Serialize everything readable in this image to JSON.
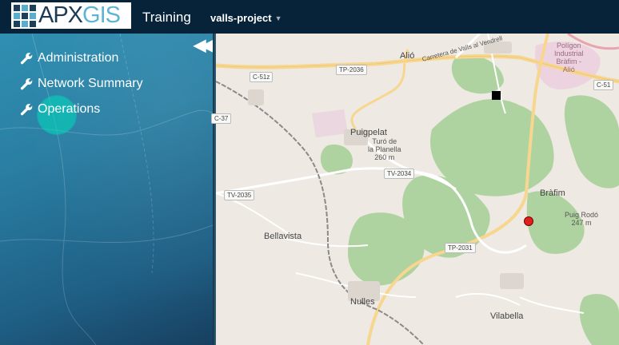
{
  "header": {
    "logo_part1": "APX",
    "logo_part2": "GIS",
    "app_title": "Training",
    "project": "valls-project"
  },
  "sidebar": {
    "items": [
      {
        "label": "Administration"
      },
      {
        "label": "Network Summary"
      },
      {
        "label": "Operations"
      }
    ]
  },
  "map": {
    "places": {
      "alio": "Alió",
      "puigpelat": "Puigpelat",
      "turo": "Turó de\nla Planella\n260 m",
      "brafim": "Bràfim",
      "puig_rodo": "Puig Rodó\n247 m",
      "bellavista": "Bellavista",
      "nulles": "Nulles",
      "vilabella": "Vilabella",
      "poligon": "Polígon\nIndustrial\nBràfim -\nAlió",
      "carretera": "Carretera de Valls al Vendrell"
    },
    "roads": {
      "c51z": "C-51z",
      "tp2036": "TP-2036",
      "c37": "C-37",
      "tv2034": "TV-2034",
      "tv2035": "TV-2035",
      "tp2031": "TP-2031",
      "c51": "C-51"
    },
    "colors": {
      "forest": "#aed3a0",
      "highway": "#f7d68f",
      "rail": "#8a8a8a",
      "marker_square": "#000000",
      "marker_circle": "#e02020"
    }
  }
}
